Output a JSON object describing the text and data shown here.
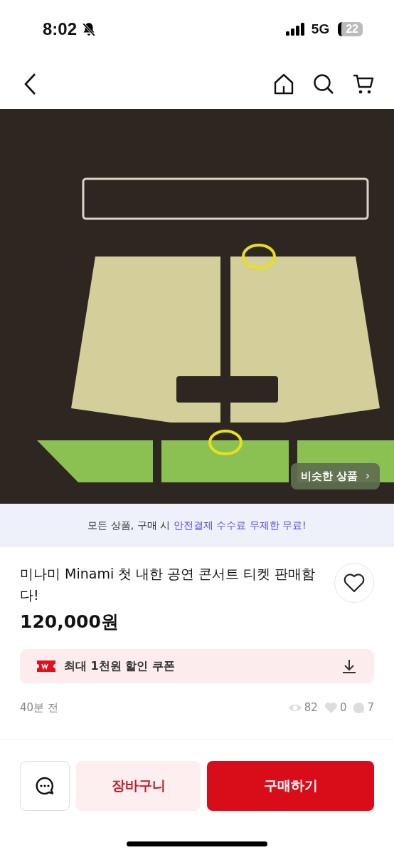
{
  "status_bar": {
    "time": "8:02",
    "network": "5G",
    "battery": "22"
  },
  "product_image": {
    "kind": "picture",
    "overlay_button": {
      "label": "비슷한 상품",
      "arrow": "›"
    }
  },
  "notice_banner": {
    "text": "모든 상품, 구매 시 **안전결제 수수료 무제한 무료!**"
  },
  "product": {
    "title": "미나미 Minami 첫 내한 공연 콘서트 티켓 판매함다!",
    "price": "120,000원",
    "liked": false
  },
  "coupon": {
    "text": "최대 1천원 할인 쿠폰"
  },
  "meta": {
    "posted": "40분 전",
    "views": "82",
    "likes": "0",
    "comments": "7"
  },
  "actions": {
    "cart": "장바구니",
    "buy": "구매하기"
  }
}
